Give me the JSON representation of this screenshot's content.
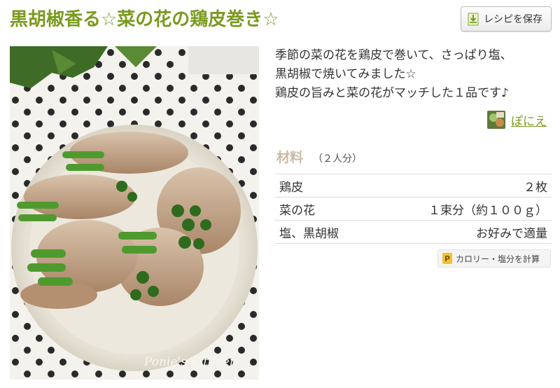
{
  "recipe": {
    "title": "黒胡椒香る☆菜の花の鶏皮巻き☆",
    "save_label": "レシピを保存",
    "description": [
      "季節の菜の花を鶏皮で巻いて、さっぱり塩、",
      "黒胡椒で焼いてみました☆",
      "鶏皮の旨みと菜の花がマッチした１品です♪"
    ],
    "author": "ぽにえ",
    "photo_watermark": "Ponie's Kitchen",
    "colors": {
      "accent": "#7a9a1e",
      "ingredients_heading": "#c9bba7"
    }
  },
  "ingredients": {
    "heading": "材料",
    "servings": "（２人分）",
    "items": [
      {
        "name": "鶏皮",
        "amount": "２枚"
      },
      {
        "name": "菜の花",
        "amount": "１束分（約１００ｇ）"
      },
      {
        "name": "塩、黒胡椒",
        "amount": "お好みで適量"
      }
    ],
    "calc_label": "カロリー・塩分を計算",
    "calc_icon": "P"
  }
}
